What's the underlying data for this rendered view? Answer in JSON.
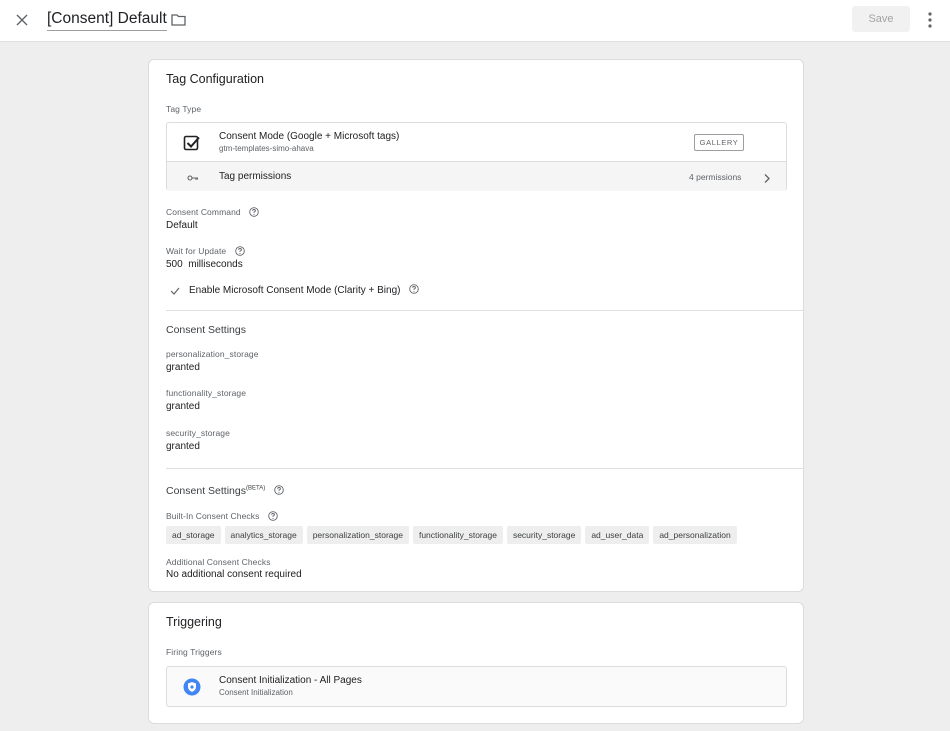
{
  "header": {
    "title": "[Consent] Default",
    "save_label": "Save"
  },
  "icons": {
    "close": "close-icon",
    "folder": "folder-icon",
    "more": "more-vert-icon",
    "template": "checkbox-checked-icon",
    "permissions": "key-icon",
    "chevron": "chevron-right-icon",
    "help": "help-circle-icon",
    "check": "check-icon",
    "trigger": "consent-trigger-icon"
  },
  "colors": {
    "accent": "#4285f4",
    "background": "#eeeeee"
  },
  "tag_config": {
    "title": "Tag Configuration",
    "tag_type_label": "Tag Type",
    "template_name": "Consent Mode (Google + Microsoft tags)",
    "template_source": "gtm-templates-simo-ahava",
    "gallery_label": "GALLERY",
    "permissions_label": "Tag permissions",
    "permissions_count": "4 permissions",
    "consent_command_label": "Consent Command",
    "consent_command_value": "Default",
    "wait_label": "Wait for Update",
    "wait_value": "500  milliseconds",
    "ms_checkbox_label": "Enable Microsoft Consent Mode (Clarity + Bing)",
    "consent_settings_title": "Consent Settings",
    "settings": [
      {
        "name": "personalization_storage",
        "value": "granted"
      },
      {
        "name": "functionality_storage",
        "value": "granted"
      },
      {
        "name": "security_storage",
        "value": "granted"
      }
    ],
    "beta_title": "Consent Settings",
    "beta_sup": "(BETA)",
    "builtin_label": "Built-In Consent Checks",
    "builtin_checks": [
      "ad_storage",
      "analytics_storage",
      "personalization_storage",
      "functionality_storage",
      "security_storage",
      "ad_user_data",
      "ad_personalization"
    ],
    "additional_label": "Additional Consent Checks",
    "additional_value": "No additional consent required"
  },
  "triggering": {
    "title": "Triggering",
    "firing_label": "Firing Triggers",
    "trigger_name": "Consent Initialization - All Pages",
    "trigger_type": "Consent Initialization"
  }
}
